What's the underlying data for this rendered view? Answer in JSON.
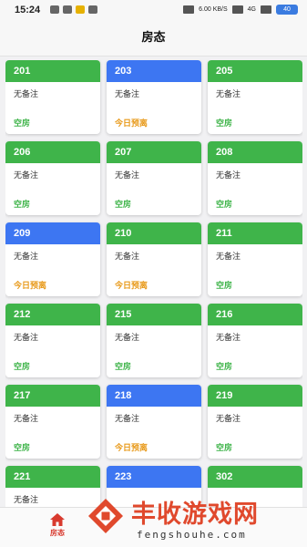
{
  "status_bar": {
    "time": "15:24",
    "speed": "6.00 KB/S",
    "network": "4G",
    "battery": "40"
  },
  "header": {
    "title": "房态"
  },
  "rooms": [
    {
      "number": "201",
      "note": "无备注",
      "status": "空房",
      "header_color": "green",
      "status_color": "green"
    },
    {
      "number": "203",
      "note": "无备注",
      "status": "今日预离",
      "header_color": "blue",
      "status_color": "orange"
    },
    {
      "number": "205",
      "note": "无备注",
      "status": "空房",
      "header_color": "green",
      "status_color": "green"
    },
    {
      "number": "206",
      "note": "无备注",
      "status": "空房",
      "header_color": "green",
      "status_color": "green"
    },
    {
      "number": "207",
      "note": "无备注",
      "status": "空房",
      "header_color": "green",
      "status_color": "green"
    },
    {
      "number": "208",
      "note": "无备注",
      "status": "空房",
      "header_color": "green",
      "status_color": "green"
    },
    {
      "number": "209",
      "note": "无备注",
      "status": "今日预离",
      "header_color": "blue",
      "status_color": "orange"
    },
    {
      "number": "210",
      "note": "无备注",
      "status": "今日预离",
      "header_color": "green",
      "status_color": "orange"
    },
    {
      "number": "211",
      "note": "无备注",
      "status": "空房",
      "header_color": "green",
      "status_color": "green"
    },
    {
      "number": "212",
      "note": "无备注",
      "status": "空房",
      "header_color": "green",
      "status_color": "green"
    },
    {
      "number": "215",
      "note": "无备注",
      "status": "空房",
      "header_color": "green",
      "status_color": "green"
    },
    {
      "number": "216",
      "note": "无备注",
      "status": "空房",
      "header_color": "green",
      "status_color": "green"
    },
    {
      "number": "217",
      "note": "无备注",
      "status": "空房",
      "header_color": "green",
      "status_color": "green"
    },
    {
      "number": "218",
      "note": "无备注",
      "status": "今日预离",
      "header_color": "blue",
      "status_color": "orange"
    },
    {
      "number": "219",
      "note": "无备注",
      "status": "空房",
      "header_color": "green",
      "status_color": "green"
    },
    {
      "number": "221",
      "note": "无备注",
      "status": "",
      "header_color": "green",
      "status_color": "green"
    },
    {
      "number": "223",
      "note": "",
      "status": "",
      "header_color": "blue",
      "status_color": "orange"
    },
    {
      "number": "302",
      "note": "",
      "status": "",
      "header_color": "green",
      "status_color": "green"
    }
  ],
  "tabbar": {
    "home_label": "房态",
    "home_icon": "home-icon"
  },
  "watermark": {
    "title": "丰收游戏网",
    "subtitle": "fengshouhe.com"
  },
  "colors": {
    "green": "#3fb44a",
    "blue": "#3d76f2",
    "orange": "#e89a1b",
    "accent": "#d83a2e"
  }
}
